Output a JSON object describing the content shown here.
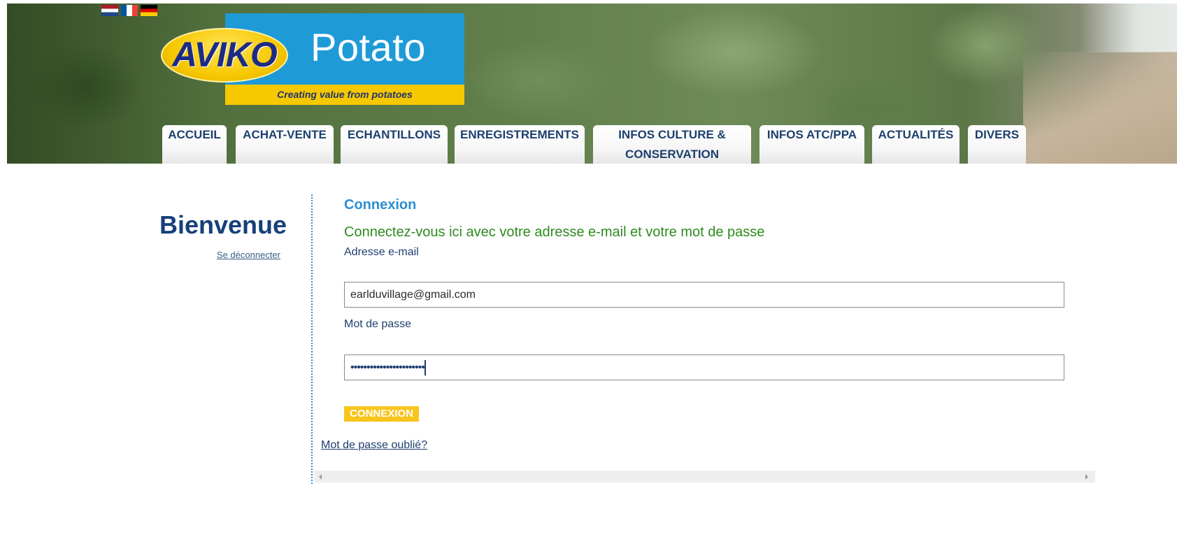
{
  "header": {
    "languages": [
      {
        "code": "nl",
        "icon": "netherlands-flag-icon"
      },
      {
        "code": "fr",
        "icon": "france-flag-icon"
      },
      {
        "code": "de",
        "icon": "germany-flag-icon"
      }
    ],
    "logo": {
      "brand": "AVIKO",
      "product": "Potato",
      "tagline": "Creating value from potatoes"
    }
  },
  "nav": {
    "tabs": [
      {
        "label": "ACCUEIL"
      },
      {
        "label": "ACHAT-VENTE"
      },
      {
        "label": "ECHANTILLONS"
      },
      {
        "label": "ENREGISTREMENTS"
      },
      {
        "label": "INFOS CULTURE & CONSERVATION"
      },
      {
        "label": "INFOS ATC/PPA"
      },
      {
        "label": "ACTUALITÉS"
      },
      {
        "label": "DIVERS"
      }
    ]
  },
  "sidebar": {
    "welcome": "Bienvenue",
    "logout_link": "Se déconnecter"
  },
  "login": {
    "title": "Connexion",
    "intro": "Connectez-vous ici avec votre adresse e-mail et votre mot de passe",
    "email_label": "Adresse e-mail",
    "email_value": "earlduvillage@gmail.com",
    "password_label": "Mot de passe",
    "password_value": "•••••••••••••••••••••••",
    "submit_label": "CONNEXION",
    "forgot_link": "Mot de passe oublié?"
  },
  "colors": {
    "brand_blue": "#1e9bd7",
    "brand_yellow": "#f6c800",
    "nav_text": "#1d3f6e",
    "intro_green": "#2e8b1e",
    "button_yellow": "#f8c51c"
  }
}
